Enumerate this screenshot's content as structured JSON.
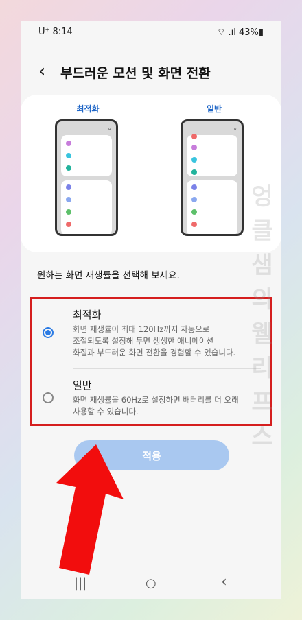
{
  "status": {
    "carrier_time": "U⁺ 8:14",
    "signal_battery": "⌔ .ıl 43%▮"
  },
  "header": {
    "back": "‹",
    "title": "부드러운 모션 및 화면 전환"
  },
  "preview": {
    "left_label": "최적화",
    "right_label": "일반",
    "search_icon": "⌕"
  },
  "prompt": "원하는 화면 재생률을 선택해 보세요.",
  "options": [
    {
      "title": "최적화",
      "description": "화면 재생률이 최대 120Hz까지 자동으로\n조절되도록 설정해 두면 생생한 애니메이션\n화질과 부드러운 화면 전환을 경험할 수 있습니다.",
      "selected": true
    },
    {
      "title": "일반",
      "description": "화면 재생률을 60Hz로 설정하면 배터리를 더 오래\n사용할 수 있습니다.",
      "selected": false
    }
  ],
  "apply_label": "적용",
  "navbar": {
    "recents": "|||",
    "home": "○",
    "back": "‹"
  },
  "watermark": "엉클샘의 웰리프스",
  "colors": {
    "accent": "#2b7be4",
    "highlight_border": "#d51e1e",
    "arrow": "#f20d0d",
    "apply_bg": "#a9c8f0"
  }
}
